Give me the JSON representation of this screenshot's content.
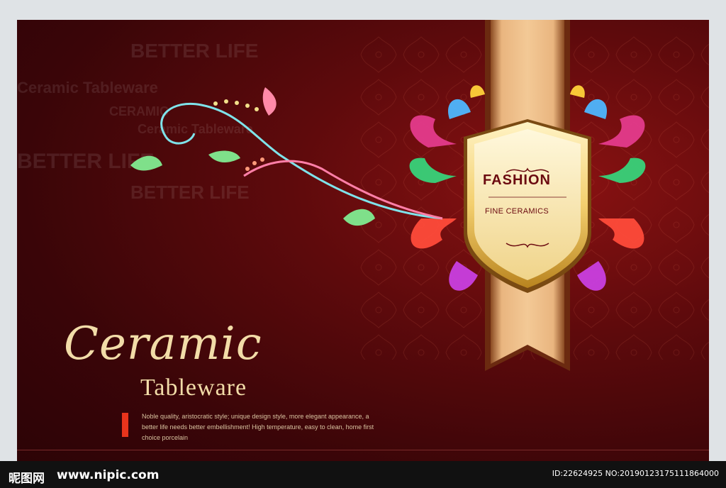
{
  "badge": {
    "title": "FASHION",
    "subtitle": "FINE CERAMICS"
  },
  "heading": {
    "script": "Ceramic",
    "sub": "Tableware"
  },
  "description": "Noble quality, aristocratic style; unique design style, more elegant appearance, a better life needs better embellishment! High temperature, easy to clean, home first choice porcelain",
  "background_words": [
    "BETTER LIFE",
    "Ceramic Tableware",
    "BETTER LIFE",
    "CERAMIC",
    "Ceramic Tableware",
    "BETTER LIFE"
  ],
  "watermark": {
    "site_cn": "昵图网",
    "url": "www.nipic.com",
    "id": "ID:22624925 NO:20190123175111864000"
  },
  "colors": {
    "background": "#5e0a0c",
    "gold": "#f2dca8",
    "ribbon": "#d9a066",
    "accent_bar": "#e8341c"
  }
}
